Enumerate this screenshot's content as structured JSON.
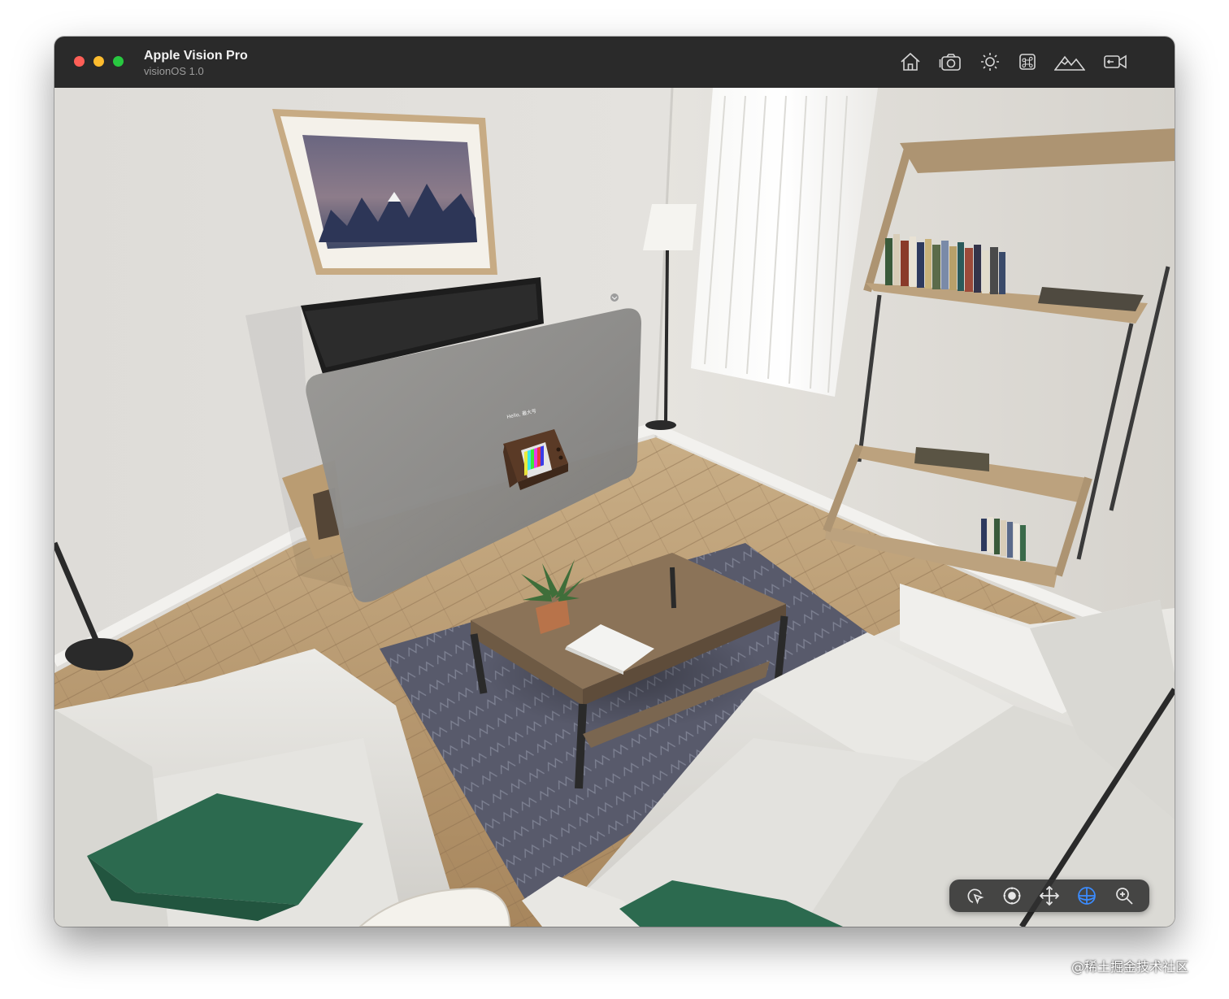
{
  "window": {
    "title": "Apple Vision Pro",
    "subtitle": "visionOS 1.0"
  },
  "toolbar": {
    "buttons": [
      {
        "name": "home",
        "icon": "house-icon"
      },
      {
        "name": "screenshot",
        "icon": "camera-icon"
      },
      {
        "name": "brightness",
        "icon": "sun-icon"
      },
      {
        "name": "keyboard-shortcuts",
        "icon": "command-icon"
      },
      {
        "name": "environment",
        "icon": "mountains-icon"
      },
      {
        "name": "record",
        "icon": "video-camera-icon"
      }
    ]
  },
  "scene": {
    "app_window_text": "Hello, 最大号"
  },
  "navigation": {
    "buttons": [
      {
        "name": "interact",
        "icon": "pointer-icon",
        "active": false
      },
      {
        "name": "look",
        "icon": "look-around-icon",
        "active": false
      },
      {
        "name": "pan",
        "icon": "move-arrows-icon",
        "active": false
      },
      {
        "name": "orbit",
        "icon": "orbit-globe-icon",
        "active": true
      },
      {
        "name": "zoom",
        "icon": "zoom-icon",
        "active": false
      }
    ]
  },
  "colors": {
    "titlebar": "#2a2a2a",
    "close": "#ff5f57",
    "minimize": "#febc2e",
    "zoom": "#28c840",
    "active_tool": "#3b8cff"
  },
  "watermark": "@稀土掘金技术社区"
}
